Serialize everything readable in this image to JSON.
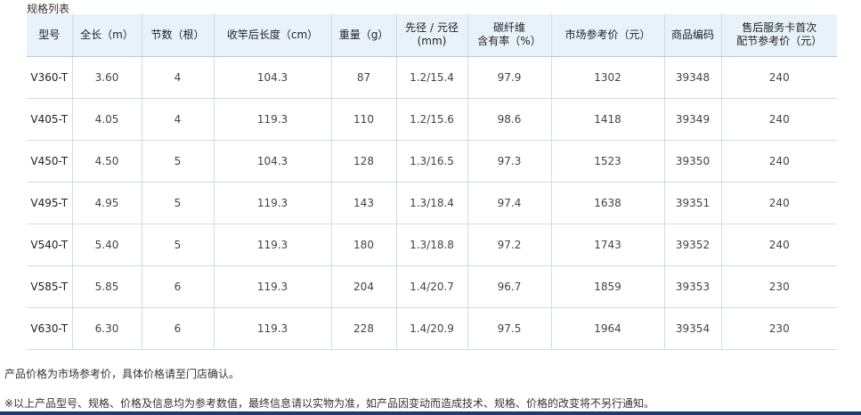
{
  "caption": "规格列表",
  "headers": [
    "型号",
    "全长（m）",
    "节数（根）",
    "收竿后长度（cm）",
    "重量（g）",
    "先径 / 元径\n(mm)",
    "碳纤维\n含有率（%）",
    "市场参考价（元）",
    "商品编码",
    "售后服务卡首次\n配节参考价（元）"
  ],
  "rows": [
    [
      "V360-T",
      "3.60",
      "4",
      "104.3",
      "87",
      "1.2/15.4",
      "97.9",
      "1302",
      "39348",
      "240"
    ],
    [
      "V405-T",
      "4.05",
      "4",
      "119.3",
      "110",
      "1.2/15.6",
      "98.6",
      "1418",
      "39349",
      "240"
    ],
    [
      "V450-T",
      "4.50",
      "5",
      "104.3",
      "128",
      "1.3/16.5",
      "97.3",
      "1523",
      "39350",
      "240"
    ],
    [
      "V495-T",
      "4.95",
      "5",
      "119.3",
      "143",
      "1.3/18.4",
      "97.4",
      "1638",
      "39351",
      "240"
    ],
    [
      "V540-T",
      "5.40",
      "5",
      "119.3",
      "180",
      "1.3/18.8",
      "97.2",
      "1743",
      "39352",
      "240"
    ],
    [
      "V585-T",
      "5.85",
      "6",
      "119.3",
      "204",
      "1.4/20.7",
      "96.7",
      "1859",
      "39353",
      "230"
    ],
    [
      "V630-T",
      "6.30",
      "6",
      "119.3",
      "228",
      "1.4/20.9",
      "97.5",
      "1964",
      "39354",
      "230"
    ]
  ],
  "notes": {
    "price_note": "产品价格为市场参考价，具体价格请至门店确认。",
    "disclaimer": "※以上产品型号、规格、价格及信息均为参考数值，最终信息请以实物为准，如产品因变动而造成技术、规格、价格的改变将不另行通知。"
  }
}
